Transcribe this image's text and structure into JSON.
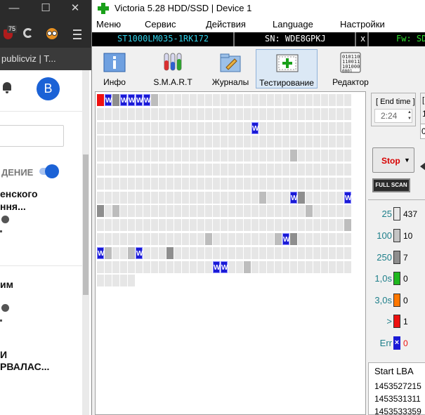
{
  "browser": {
    "ublock_badge": "75",
    "tab_title": "publicviz | T...",
    "avatar_letter": "B",
    "toggle_label": "ДЕНИЕ",
    "item1_line1": "енского",
    "item1_line2": "ння...",
    "item2_line1": "им",
    "item3_line1": "И",
    "item3_line2": "РВАЛАС..."
  },
  "window": {
    "title": "Victoria 5.28 HDD/SSD | Device 1"
  },
  "menu": {
    "items": [
      "Меню",
      "Сервис",
      "Действия",
      "Language",
      "Настройки"
    ]
  },
  "drive": {
    "model": "ST1000LM035-1RK172",
    "serial": "SN: WDE8GPKJ",
    "close": "x",
    "firmware": "Fw: SD"
  },
  "toolbar": {
    "items": [
      "Инфо",
      "S.M.A.R.T",
      "Журналы",
      "Тестирование",
      "Редактор"
    ]
  },
  "controls": {
    "end_time_label": "[ End time ]",
    "end_time_value": "2:24",
    "stub_bracket": "[",
    "stub_digit1": "1",
    "stub_digit2": "0",
    "stop_label": "Stop",
    "full_scan": "FULL SCAN"
  },
  "legend": {
    "colors": {
      "w": "#1a1ad6",
      "red": "#ee1111",
      "orange": "#ff7700",
      "green": "#1fb81f"
    },
    "rows": [
      {
        "label": "25",
        "count": "437",
        "color": "#e8e8e8",
        "label_color": "#1e7f8a"
      },
      {
        "label": "100",
        "count": "10",
        "color": "#c4c4c4",
        "label_color": "#1e7f8a"
      },
      {
        "label": "250",
        "count": "7",
        "color": "#8e8e8e",
        "label_color": "#1e7f8a"
      },
      {
        "label": "1,0s",
        "count": "0",
        "color": "#1fb81f",
        "label_color": "#1e7f8a"
      },
      {
        "label": "3,0s",
        "count": "0",
        "color": "#ff7700",
        "label_color": "#1e7f8a"
      },
      {
        "label": ">",
        "count": "1",
        "color": "#ee1111",
        "label_color": "#1e7f8a"
      },
      {
        "label": "Err",
        "count": "0",
        "color": "#1a1ad6",
        "label_color": "#1e7f8a"
      }
    ]
  },
  "lba": {
    "header": "Start LBA",
    "rows": [
      "1453527215",
      "1453531311",
      "1453533359"
    ]
  },
  "scan": {
    "cols": 33,
    "full_rows": 13,
    "last_row_count": 5,
    "blocks": [
      {
        "r": 0,
        "c": 0,
        "t": "red"
      },
      {
        "r": 0,
        "c": 1,
        "t": "w"
      },
      {
        "r": 0,
        "c": 2,
        "t": "g2"
      },
      {
        "r": 0,
        "c": 3,
        "t": "w"
      },
      {
        "r": 0,
        "c": 4,
        "t": "w"
      },
      {
        "r": 0,
        "c": 5,
        "t": "w"
      },
      {
        "r": 0,
        "c": 6,
        "t": "w"
      },
      {
        "r": 0,
        "c": 7,
        "t": "g1"
      },
      {
        "r": 2,
        "c": 20,
        "t": "w"
      },
      {
        "r": 4,
        "c": 25,
        "t": "g1"
      },
      {
        "r": 7,
        "c": 21,
        "t": "g1"
      },
      {
        "r": 7,
        "c": 25,
        "t": "w"
      },
      {
        "r": 7,
        "c": 26,
        "t": "g2"
      },
      {
        "r": 7,
        "c": 32,
        "t": "w"
      },
      {
        "r": 8,
        "c": 0,
        "t": "g2"
      },
      {
        "r": 8,
        "c": 2,
        "t": "g1"
      },
      {
        "r": 8,
        "c": 27,
        "t": "g1"
      },
      {
        "r": 9,
        "c": 32,
        "t": "g1"
      },
      {
        "r": 10,
        "c": 14,
        "t": "g1"
      },
      {
        "r": 10,
        "c": 23,
        "t": "g1"
      },
      {
        "r": 10,
        "c": 24,
        "t": "w"
      },
      {
        "r": 10,
        "c": 25,
        "t": "g2"
      },
      {
        "r": 11,
        "c": 0,
        "t": "w"
      },
      {
        "r": 11,
        "c": 1,
        "t": "g1"
      },
      {
        "r": 11,
        "c": 4,
        "t": "g1"
      },
      {
        "r": 11,
        "c": 5,
        "t": "w"
      },
      {
        "r": 11,
        "c": 9,
        "t": "g2"
      },
      {
        "r": 12,
        "c": 15,
        "t": "w"
      },
      {
        "r": 12,
        "c": 16,
        "t": "w"
      },
      {
        "r": 12,
        "c": 19,
        "t": "g1"
      }
    ],
    "w_letter": "W"
  }
}
